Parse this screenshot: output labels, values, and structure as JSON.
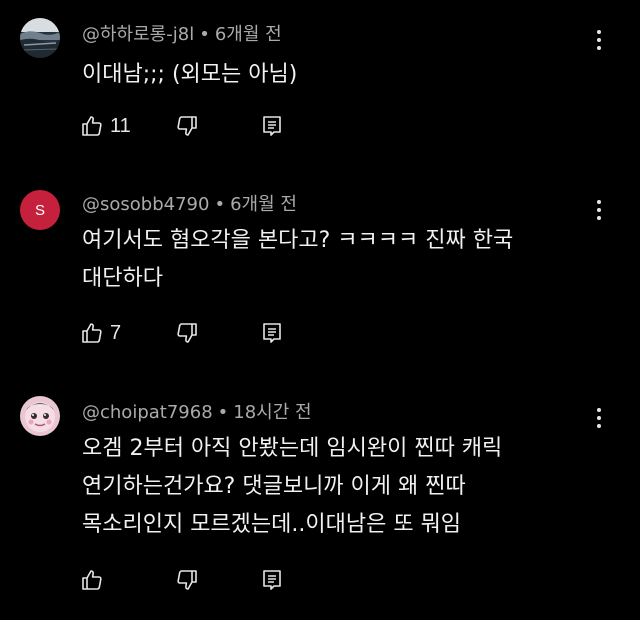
{
  "comments": [
    {
      "author": "@하하로롱-j8l",
      "time": "6개월 전",
      "avatar_type": "landscape-photo",
      "lines": [
        "이대남;;; (외모는 아님)"
      ],
      "likes": "11",
      "icons": {
        "like": "thumb-up-icon",
        "dislike": "thumb-down-icon",
        "reply": "reply-icon",
        "menu": "more-vert-icon"
      }
    },
    {
      "author": "@sosobb4790",
      "time": "6개월 전",
      "avatar_type": "letter",
      "avatar_letter": "S",
      "avatar_color": "#c5213c",
      "lines": [
        "여기서도 혐오각을 본다고? ㅋㅋㅋㅋ 진짜 한국",
        "대단하다"
      ],
      "likes": "7",
      "icons": {
        "like": "thumb-up-icon",
        "dislike": "thumb-down-icon",
        "reply": "reply-icon",
        "menu": "more-vert-icon"
      }
    },
    {
      "author": "@choipat7968",
      "time": "18시간 전",
      "avatar_type": "character-photo",
      "lines": [
        "오겜 2부터 아직 안봤는데 임시완이 찐따 캐릭",
        "연기하는건가요? 댓글보니까 이게 왜 찐따",
        "목소리인지 모르겠는데..이대남은 또 뭐임"
      ],
      "likes": "",
      "icons": {
        "like": "thumb-up-icon",
        "dislike": "thumb-down-icon",
        "reply": "reply-icon",
        "menu": "more-vert-icon"
      }
    }
  ],
  "meta_separator": "•"
}
